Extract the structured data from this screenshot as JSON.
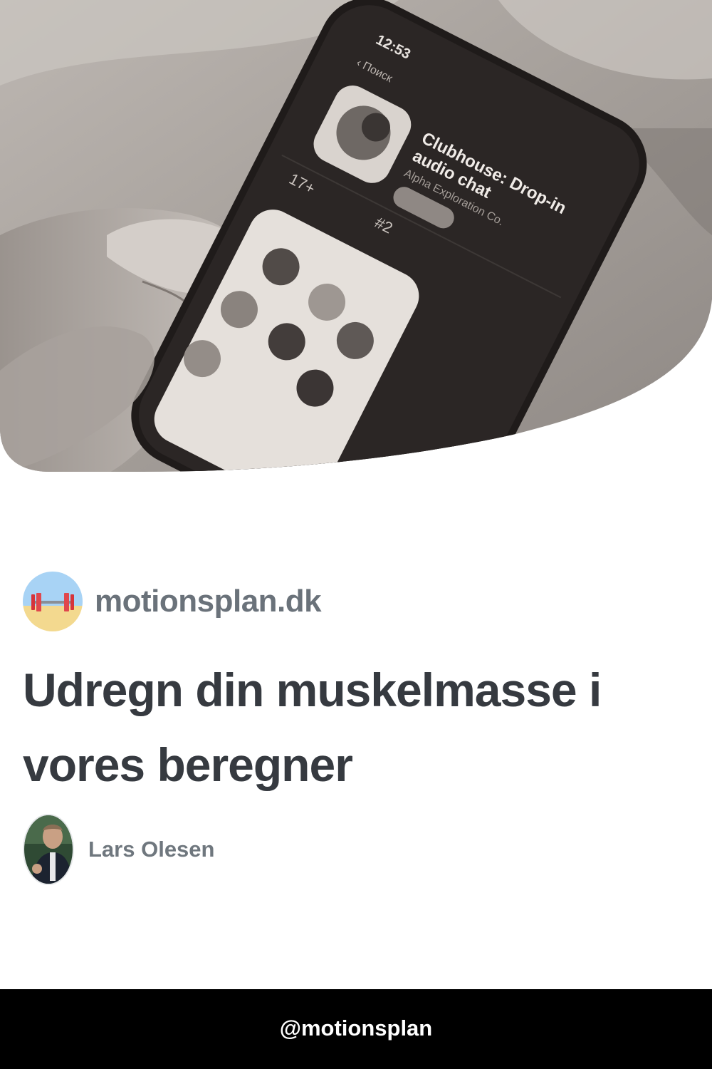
{
  "hero": {
    "image": "grayscale photo of a hand holding a smartphone showing an app store page",
    "phone_screen": {
      "time": "12:53",
      "back_label": "Поиск",
      "app_title_line1": "Clubhouse: Drop-in",
      "app_title_line2": "audio chat",
      "developer": "Alpha Exploration Co.",
      "age_rating": "17+",
      "chart_rank": "#2"
    }
  },
  "site": {
    "logo_icon": "barbell-icon",
    "name": "motionsplan.dk"
  },
  "article": {
    "title": "Udregn din muskelmasse i vores beregner"
  },
  "author": {
    "name": "Lars Olesen"
  },
  "footer": {
    "handle": "@motionsplan"
  },
  "colors": {
    "site_name": "#6a727a",
    "title": "#363a40",
    "author": "#6f777e",
    "footer_bg": "#000000",
    "footer_text": "#ffffff"
  }
}
